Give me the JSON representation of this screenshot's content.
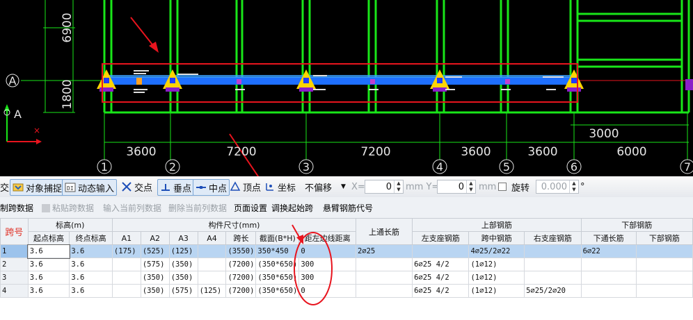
{
  "drawing": {
    "left_dims": [
      "6900",
      "1800"
    ],
    "bottom_dims": [
      "3600",
      "7200",
      "7200",
      "3600",
      "3600",
      "6000"
    ],
    "aux_dim": "3000",
    "axis_labels": [
      "1",
      "2",
      "3",
      "4",
      "5",
      "6",
      "7"
    ],
    "row_axis": "A",
    "ucs_label": "A",
    "colors": {
      "background": "#000000",
      "grid_lines": "#00ff00",
      "beam": "#1e6fff",
      "highlight": "#e8141e",
      "support": "#ffd400"
    }
  },
  "toolbar": {
    "cut_label": "交",
    "snap_label": "对象捕捉",
    "dynamic_input_label": "动态输入",
    "intersection_label": "交点",
    "perpendicular_label": "垂点",
    "midpoint_label": "中点",
    "vertex_label": "顶点",
    "coordinate_label": "坐标",
    "offset_select": "不偏移",
    "x_label": "X=",
    "x_value": "0",
    "y_label": "mm Y=",
    "y_value": "0",
    "mm_label": "mm",
    "rotate_label": "旋转",
    "rotate_value": "0.000",
    "degree": "°"
  },
  "toolbar2": {
    "copy_span": "复制跨数据",
    "paste_span": "粘贴跨数据",
    "input_col": "输入当前列数据",
    "delete_col": "删除当前列数据",
    "page_setup": "页面设置",
    "swap_start": "调换起始跨",
    "cantilever": "悬臂钢筋代号"
  },
  "table": {
    "corner": "跨号",
    "groups": {
      "elevation": "标高(m)",
      "size": "构件尺寸(mm)",
      "top_long": "上通长筋",
      "top_rebar": "上部钢筋",
      "bottom_rebar": "下部钢筋"
    },
    "headers": {
      "start_elev": "起点标高",
      "end_elev": "终点标高",
      "a1": "A1",
      "a2": "A2",
      "a3": "A3",
      "a4": "A4",
      "span": "跨长",
      "section": "截面(B*H)",
      "dist": "距左边线距离",
      "left_seat": "左支座钢筋",
      "mid_span": "跨中钢筋",
      "right_seat": "右支座钢筋",
      "bottom_long": "下通长筋",
      "bottom_bar": "下部钢筋"
    },
    "rows": [
      {
        "no": "1",
        "start": "3.6",
        "end": "3.6",
        "a1": "(175)",
        "a2": "(525)",
        "a3": "(125)",
        "a4": "",
        "span": "(3550)",
        "section": "350*450",
        "dist": "0",
        "top_long": "2⌀25",
        "left": "",
        "mid": "4⌀25/2⌀22",
        "right": "",
        "bottom_long": "6⌀22",
        "bottom": ""
      },
      {
        "no": "2",
        "start": "3.6",
        "end": "3.6",
        "a1": "",
        "a2": "(575)",
        "a3": "(350)",
        "a4": "",
        "span": "(7200)",
        "section": "(350*650)",
        "dist": "300",
        "top_long": "",
        "left": "6⌀25 4/2",
        "mid": "(1⌀12)",
        "right": "",
        "bottom_long": "",
        "bottom": ""
      },
      {
        "no": "3",
        "start": "3.6",
        "end": "3.6",
        "a1": "",
        "a2": "(350)",
        "a3": "(350)",
        "a4": "",
        "span": "(7200)",
        "section": "(350*650)",
        "dist": "300",
        "top_long": "",
        "left": "6⌀25 4/2",
        "mid": "(1⌀12)",
        "right": "",
        "bottom_long": "",
        "bottom": ""
      },
      {
        "no": "4",
        "start": "3.6",
        "end": "3.6",
        "a1": "",
        "a2": "(350)",
        "a3": "(575)",
        "a4": "(125)",
        "span": "(7200)",
        "section": "(350*650)",
        "dist": "0",
        "top_long": "",
        "left": "6⌀25 4/2",
        "mid": "(1⌀12)",
        "right": "5⌀25/2⌀20",
        "bottom_long": "",
        "bottom": ""
      }
    ]
  }
}
